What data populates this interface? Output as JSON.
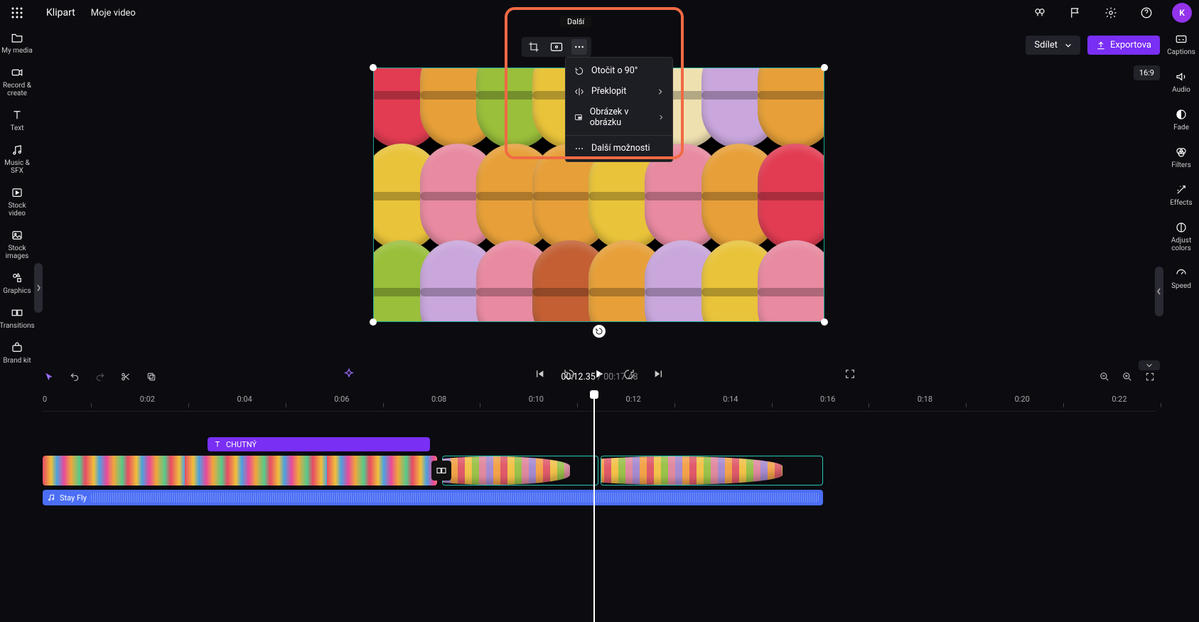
{
  "header": {
    "app_name": "Klipart",
    "project_title": "Moje video",
    "avatar_letter": "K"
  },
  "actions": {
    "share_label": "Sdílet",
    "export_label": "Exportova",
    "aspect_label": "16:9"
  },
  "left_sidebar": {
    "items": [
      {
        "icon": "folder",
        "label": "My media"
      },
      {
        "icon": "camera",
        "label": "Record & create"
      },
      {
        "icon": "text",
        "label": "Text"
      },
      {
        "icon": "music",
        "label": "Music & SFX"
      },
      {
        "icon": "video",
        "label": "Stock video"
      },
      {
        "icon": "image",
        "label": "Stock images"
      },
      {
        "icon": "shapes",
        "label": "Graphics"
      },
      {
        "icon": "trans",
        "label": "Transitions"
      },
      {
        "icon": "brand",
        "label": "Brand kit"
      }
    ]
  },
  "right_sidebar": {
    "items": [
      {
        "icon": "cc",
        "label": "Captions"
      },
      {
        "icon": "audio",
        "label": "Audio"
      },
      {
        "icon": "fade",
        "label": "Fade"
      },
      {
        "icon": "filter",
        "label": "Filters"
      },
      {
        "icon": "fx",
        "label": "Effects"
      },
      {
        "icon": "adjust",
        "label": "Adjust colors"
      },
      {
        "icon": "speed",
        "label": "Speed"
      }
    ]
  },
  "floating_toolbar": {
    "tooltip": "Další",
    "buttons": [
      "crop",
      "fit",
      "more"
    ]
  },
  "context_menu": {
    "items": [
      {
        "icon": "rotate",
        "label": "Otočit o 90°",
        "submenu": false
      },
      {
        "icon": "flip",
        "label": "Překlopit",
        "submenu": true
      },
      {
        "icon": "pip",
        "label": "Obrázek v obrázku",
        "submenu": true
      },
      {
        "icon": "more",
        "label": "Další možnosti",
        "submenu": false,
        "separator_before": true
      }
    ]
  },
  "timecode": {
    "current": "00:12.35",
    "duration": "00:17.48"
  },
  "ruler": {
    "ticks": [
      "0",
      "0:02",
      "0:04",
      "0:06",
      "0:08",
      "0:10",
      "0:12",
      "0:14",
      "0:16",
      "0:18",
      "0:20",
      "0:22"
    ]
  },
  "tracks": {
    "text_clip_label": "CHUTNÝ",
    "audio_clip_label": "Stay Fly"
  },
  "colors": {
    "accent": "#7a2ff5",
    "highlight": "#f06a43",
    "teal": "#1aa89a",
    "audio": "#4b6ef5"
  }
}
